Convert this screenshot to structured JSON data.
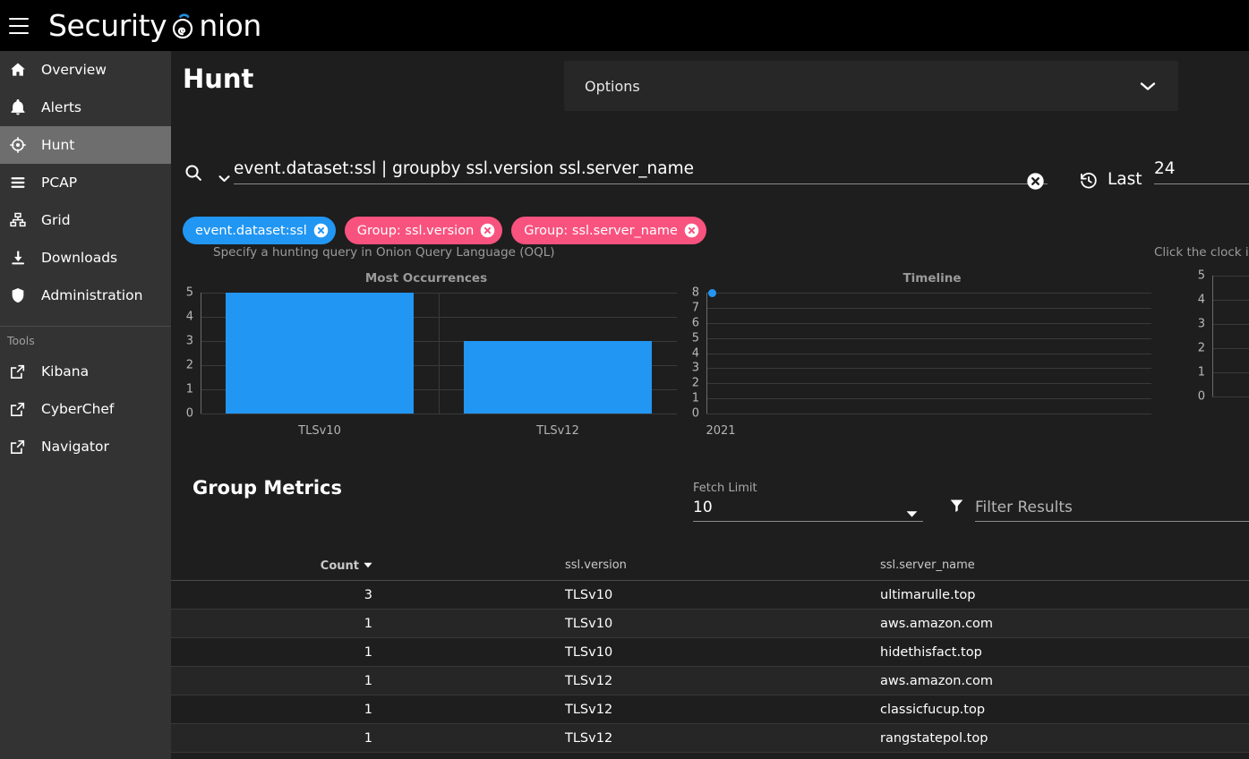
{
  "app": {
    "brand_prefix": "Security",
    "brand_suffix": "nion",
    "menu_icon": "hamburger-icon"
  },
  "sidebar": {
    "items": [
      {
        "label": "Overview",
        "icon": "home-icon",
        "active": false
      },
      {
        "label": "Alerts",
        "icon": "bell-icon",
        "active": false
      },
      {
        "label": "Hunt",
        "icon": "crosshair-icon",
        "active": true
      },
      {
        "label": "PCAP",
        "icon": "lines-icon",
        "active": false
      },
      {
        "label": "Grid",
        "icon": "grid-icon",
        "active": false
      },
      {
        "label": "Downloads",
        "icon": "download-icon",
        "active": false
      },
      {
        "label": "Administration",
        "icon": "shield-icon",
        "active": false
      }
    ],
    "tools_header": "Tools",
    "tools": [
      {
        "label": "Kibana",
        "icon": "external-link-icon"
      },
      {
        "label": "CyberChef",
        "icon": "external-link-icon"
      },
      {
        "label": "Navigator",
        "icon": "external-link-icon"
      }
    ]
  },
  "header": {
    "title": "Hunt",
    "options_label": "Options",
    "options_chevron": "chevron-down-icon"
  },
  "query": {
    "search_icon": "search-icon",
    "history_chevron": "chevron-down-icon",
    "value": "event.dataset:ssl | groupby ssl.version ssl.server_name",
    "clear_icon": "clear-circle-icon",
    "hint": "Specify a hunting query in Onion Query Language (OQL)",
    "clock_icon": "clock-history-icon",
    "time_last_label": "Last",
    "time_value": "24",
    "time_hint": "Click the clock i"
  },
  "chips": [
    {
      "label": "event.dataset:ssl",
      "color": "#2196f3",
      "close_icon": "chip-close-icon"
    },
    {
      "label": "Group: ssl.version",
      "color": "#f8527e",
      "close_icon": "chip-close-icon"
    },
    {
      "label": "Group: ssl.server_name",
      "color": "#f8527e",
      "close_icon": "chip-close-icon"
    }
  ],
  "chart_data": [
    {
      "type": "bar",
      "title": "Most Occurrences",
      "categories": [
        "TLSv10",
        "TLSv12"
      ],
      "values": [
        5,
        3
      ],
      "yticks": [
        5,
        4,
        3,
        2,
        1,
        0
      ],
      "ylim": [
        0,
        5
      ],
      "xlabel": "",
      "ylabel": "",
      "grid": true,
      "legend": "none",
      "bar_color": "#2196f3"
    },
    {
      "type": "scatter",
      "title": "Timeline",
      "x": [
        "2021"
      ],
      "values": [
        8
      ],
      "yticks": [
        8,
        7,
        6,
        5,
        4,
        3,
        2,
        1,
        0
      ],
      "ylim": [
        0,
        8
      ],
      "xlabel": "",
      "ylabel": "",
      "grid": true,
      "legend": "none",
      "point_color": "#2196f3"
    },
    {
      "type": "bar",
      "title": "",
      "categories": [],
      "values": [],
      "yticks": [
        5,
        4,
        3,
        2,
        1,
        0
      ],
      "ylim": [
        0,
        5
      ],
      "grid": true,
      "legend": "none",
      "note": "partially visible at right edge"
    }
  ],
  "group_metrics": {
    "title": "Group Metrics",
    "fetch_limit_label": "Fetch Limit",
    "fetch_limit_value": "10",
    "fetch_arrow_icon": "dropdown-arrow-icon",
    "filter_icon": "filter-icon",
    "filter_placeholder": "Filter Results",
    "columns": [
      {
        "key": "count",
        "label": "Count",
        "sorted": true,
        "sort_icon": "sort-descending-icon"
      },
      {
        "key": "version",
        "label": "ssl.version",
        "sorted": false
      },
      {
        "key": "server",
        "label": "ssl.server_name",
        "sorted": false
      }
    ],
    "rows": [
      {
        "count": "3",
        "version": "TLSv10",
        "server": "ultimarulle.top"
      },
      {
        "count": "1",
        "version": "TLSv10",
        "server": "aws.amazon.com"
      },
      {
        "count": "1",
        "version": "TLSv10",
        "server": "hidethisfact.top"
      },
      {
        "count": "1",
        "version": "TLSv12",
        "server": "aws.amazon.com"
      },
      {
        "count": "1",
        "version": "TLSv12",
        "server": "classicfucup.top"
      },
      {
        "count": "1",
        "version": "TLSv12",
        "server": "rangstatepol.top"
      }
    ]
  }
}
